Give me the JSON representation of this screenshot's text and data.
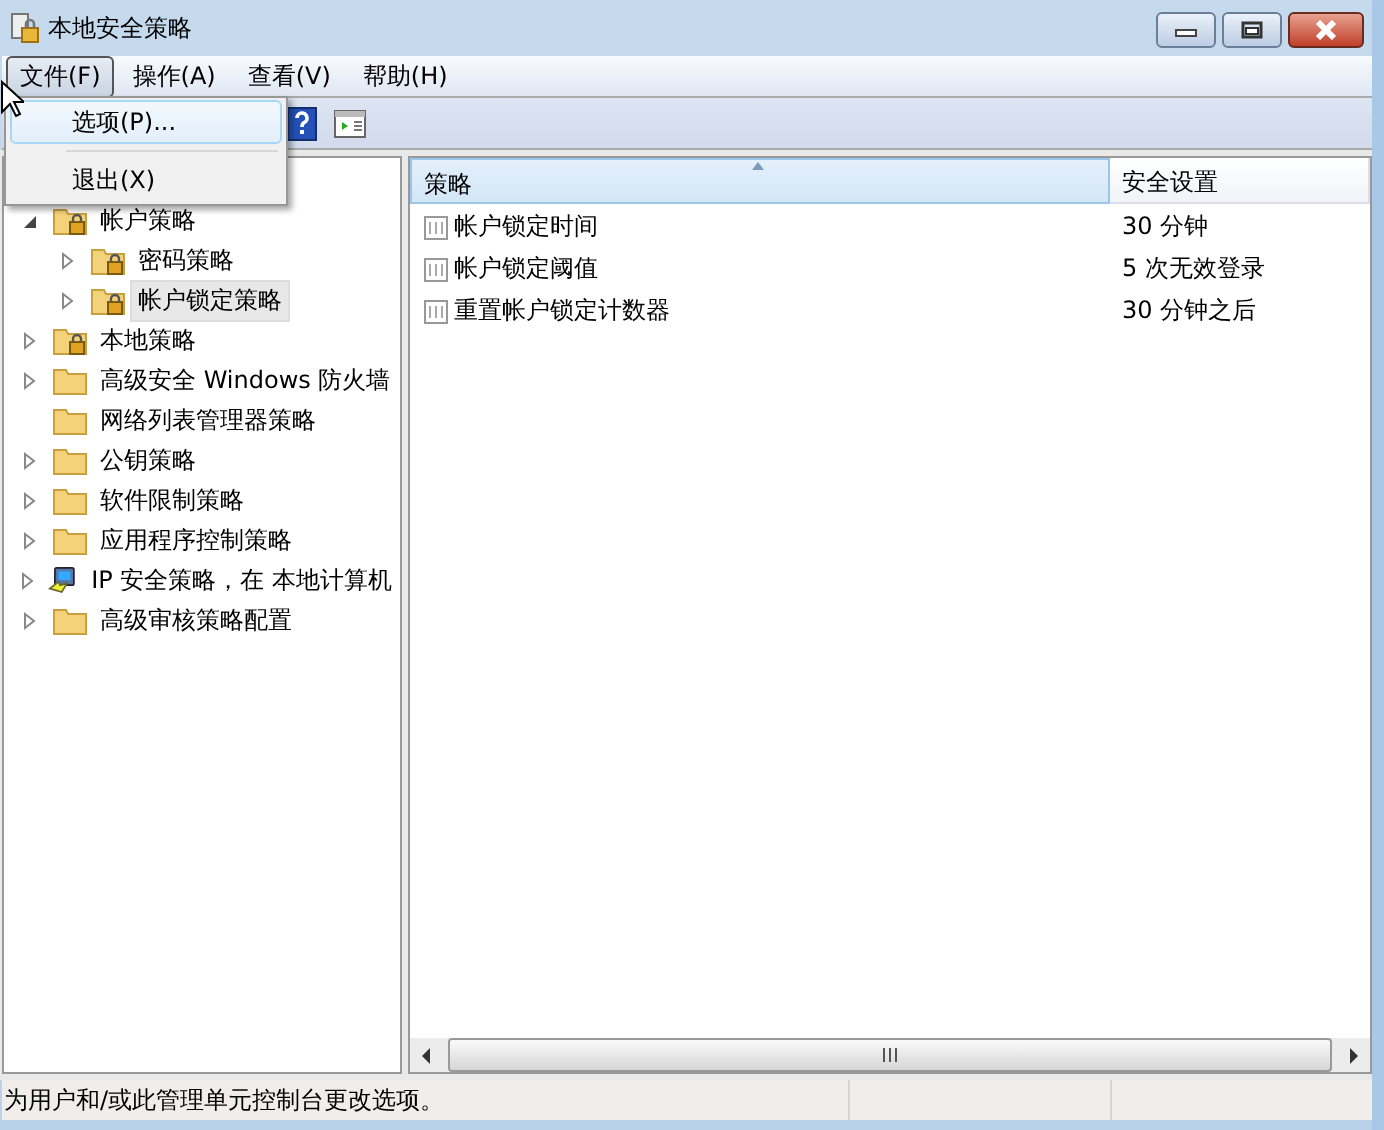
{
  "window": {
    "title": "本地安全策略"
  },
  "menu_bar": [
    {
      "label": "文件(F)",
      "selected": true
    },
    {
      "label": "操作(A)",
      "selected": false
    },
    {
      "label": "查看(V)",
      "selected": false
    },
    {
      "label": "帮助(H)",
      "selected": false
    }
  ],
  "file_menu": [
    {
      "label": "选项(P)...",
      "selected": true
    },
    {
      "label": "退出(X)",
      "selected": false
    }
  ],
  "tree": [
    {
      "label": "帐户策略",
      "kind": "locked-folder",
      "expandable": true,
      "expanded": true,
      "selected": false,
      "children": [
        {
          "label": "密码策略",
          "kind": "locked-folder",
          "expandable": true,
          "expanded": false,
          "selected": false
        },
        {
          "label": "帐户锁定策略",
          "kind": "locked-folder",
          "expandable": true,
          "expanded": false,
          "selected": true
        }
      ]
    },
    {
      "label": "本地策略",
      "kind": "locked-folder",
      "expandable": true,
      "expanded": false,
      "selected": false
    },
    {
      "label": "高级安全 Windows 防火墙",
      "kind": "folder",
      "expandable": true,
      "expanded": false,
      "selected": false
    },
    {
      "label": "网络列表管理器策略",
      "kind": "folder",
      "expandable": false,
      "selected": false
    },
    {
      "label": "公钥策略",
      "kind": "folder",
      "expandable": true,
      "expanded": false,
      "selected": false
    },
    {
      "label": "软件限制策略",
      "kind": "folder",
      "expandable": true,
      "expanded": false,
      "selected": false
    },
    {
      "label": "应用程序控制策略",
      "kind": "folder",
      "expandable": true,
      "expanded": false,
      "selected": false
    },
    {
      "label": "IP 安全策略，在 本地计算机",
      "kind": "network",
      "expandable": true,
      "expanded": false,
      "selected": false
    },
    {
      "label": "高级审核策略配置",
      "kind": "folder",
      "expandable": true,
      "expanded": false,
      "selected": false
    }
  ],
  "table": {
    "columns": [
      "策略",
      "安全设置"
    ],
    "rows": [
      [
        "帐户锁定时间",
        "30 分钟"
      ],
      [
        "帐户锁定阈值",
        "5 次无效登录"
      ],
      [
        "重置帐户锁定计数器",
        "30 分钟之后"
      ]
    ]
  },
  "status_bar": "为用户和/或此管理单元控制台更改选项。"
}
